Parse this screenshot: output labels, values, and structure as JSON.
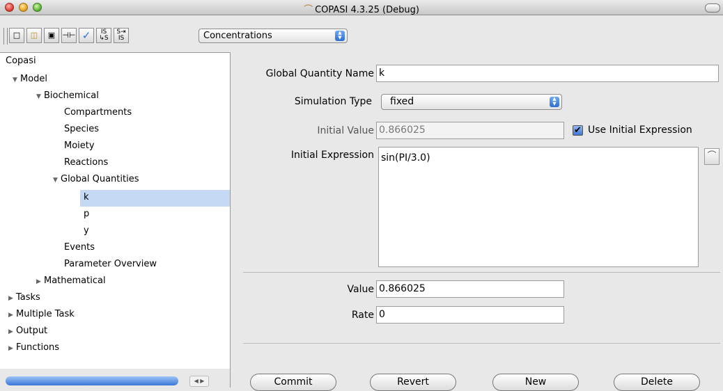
{
  "window": {
    "title": "COPASI 4.3.25 (Debug)"
  },
  "toolbar": {
    "buttons": [
      {
        "name": "new-file",
        "glyph": "🗋"
      },
      {
        "name": "open-folder",
        "glyph": "📂"
      },
      {
        "name": "save",
        "glyph": "💾"
      },
      {
        "name": "slider",
        "glyph": "⊣⊢"
      },
      {
        "name": "check",
        "glyph": "✓"
      },
      {
        "name": "is-to-s",
        "top": "IS",
        "bottom": "↳S"
      },
      {
        "name": "s-to-is",
        "top": "S⇥",
        "bottom": "IS"
      }
    ],
    "mode_select": "Concentrations"
  },
  "tree": {
    "items": [
      {
        "label": "Copasi",
        "arrow": ""
      },
      {
        "label": "Model",
        "arrow": "▼"
      },
      {
        "label": "Biochemical",
        "arrow": "▼"
      },
      {
        "label": "Compartments",
        "arrow": ""
      },
      {
        "label": "Species",
        "arrow": ""
      },
      {
        "label": "Moiety",
        "arrow": ""
      },
      {
        "label": "Reactions",
        "arrow": ""
      },
      {
        "label": "Global Quantities",
        "arrow": "▼"
      },
      {
        "label": "k",
        "arrow": ""
      },
      {
        "label": "p",
        "arrow": ""
      },
      {
        "label": "y",
        "arrow": ""
      },
      {
        "label": "Events",
        "arrow": ""
      },
      {
        "label": "Parameter Overview",
        "arrow": ""
      },
      {
        "label": "Mathematical",
        "arrow": "▶"
      },
      {
        "label": "Tasks",
        "arrow": "▶"
      },
      {
        "label": "Multiple Task",
        "arrow": "▶"
      },
      {
        "label": "Output",
        "arrow": "▶"
      },
      {
        "label": "Functions",
        "arrow": "▶"
      }
    ],
    "selected": "k"
  },
  "form": {
    "name_label": "Global Quantity Name",
    "name_value": "k",
    "sim_type_label": "Simulation Type",
    "sim_type_value": "fixed",
    "initial_value_label": "Initial Value",
    "initial_value": "0.866025",
    "use_initial_expression_label": "Use Initial Expression",
    "use_initial_expression": true,
    "initial_expression_label": "Initial Expression",
    "initial_expression": "sin(PI/3.0)",
    "value_label": "Value",
    "value": "0.866025",
    "rate_label": "Rate",
    "rate": "0"
  },
  "buttons": {
    "commit": "Commit",
    "revert": "Revert",
    "new": "New",
    "delete": "Delete"
  },
  "colors": {
    "selection": "#c5d9f5",
    "accent": "#3778d8"
  }
}
